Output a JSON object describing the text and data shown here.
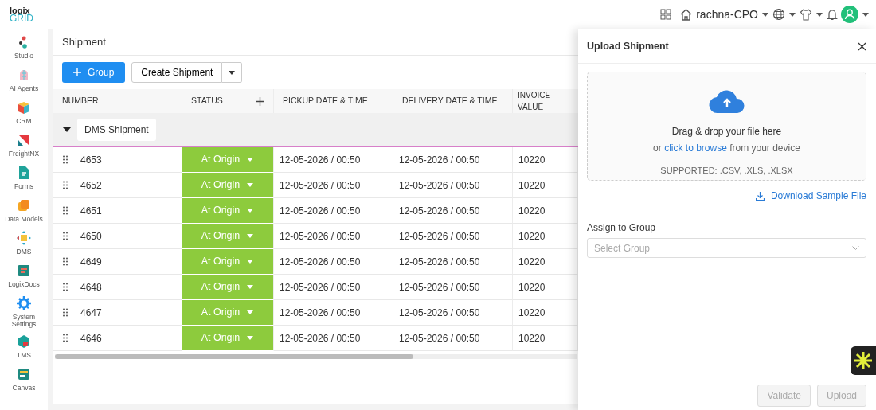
{
  "logo": {
    "top": "logix",
    "bottom": "GRID"
  },
  "header": {
    "workspace": "rachna-CPO"
  },
  "sidebar": {
    "items": [
      {
        "label": "Studio"
      },
      {
        "label": "AI Agents"
      },
      {
        "label": "CRM"
      },
      {
        "label": "FreightNX"
      },
      {
        "label": "Forms"
      },
      {
        "label": "Data Models"
      },
      {
        "label": "DMS"
      },
      {
        "label": "LogixDocs"
      },
      {
        "label": "System Settings"
      },
      {
        "label": "TMS"
      },
      {
        "label": "Canvas"
      }
    ]
  },
  "page": {
    "title": "Shipment",
    "group_button": "Group",
    "create_button": "Create Shipment"
  },
  "table": {
    "columns": [
      "NUMBER",
      "STATUS",
      "PICKUP DATE & TIME",
      "DELIVERY DATE & TIME",
      "INVOICE VALUE"
    ],
    "group": {
      "label": "DMS Shipment",
      "expanded": true
    },
    "rows": [
      {
        "number": "4653",
        "status": "At Origin",
        "pickup": "12-05-2026 / 00:50",
        "delivery": "12-05-2026 / 00:50",
        "invoice": "10220"
      },
      {
        "number": "4652",
        "status": "At Origin",
        "pickup": "12-05-2026 / 00:50",
        "delivery": "12-05-2026 / 00:50",
        "invoice": "10220"
      },
      {
        "number": "4651",
        "status": "At Origin",
        "pickup": "12-05-2026 / 00:50",
        "delivery": "12-05-2026 / 00:50",
        "invoice": "10220"
      },
      {
        "number": "4650",
        "status": "At Origin",
        "pickup": "12-05-2026 / 00:50",
        "delivery": "12-05-2026 / 00:50",
        "invoice": "10220"
      },
      {
        "number": "4649",
        "status": "At Origin",
        "pickup": "12-05-2026 / 00:50",
        "delivery": "12-05-2026 / 00:50",
        "invoice": "10220"
      },
      {
        "number": "4648",
        "status": "At Origin",
        "pickup": "12-05-2026 / 00:50",
        "delivery": "12-05-2026 / 00:50",
        "invoice": "10220"
      },
      {
        "number": "4647",
        "status": "At Origin",
        "pickup": "12-05-2026 / 00:50",
        "delivery": "12-05-2026 / 00:50",
        "invoice": "10220"
      },
      {
        "number": "4646",
        "status": "At Origin",
        "pickup": "12-05-2026 / 00:50",
        "delivery": "12-05-2026 / 00:50",
        "invoice": "10220"
      }
    ]
  },
  "drawer": {
    "title": "Upload Shipment",
    "drop_title": "Drag & drop your file here",
    "browse_prefix": "or ",
    "browse_link": "click to browse",
    "browse_suffix": " from your device",
    "supported": "SUPPORTED: .CSV, .XLS, .XLSX",
    "download_link": "Download Sample File",
    "group_label": "Assign to Group",
    "group_placeholder": "Select Group",
    "buttons": [
      {
        "label": "Validate",
        "disabled": true
      },
      {
        "label": "Upload",
        "disabled": true
      }
    ]
  }
}
